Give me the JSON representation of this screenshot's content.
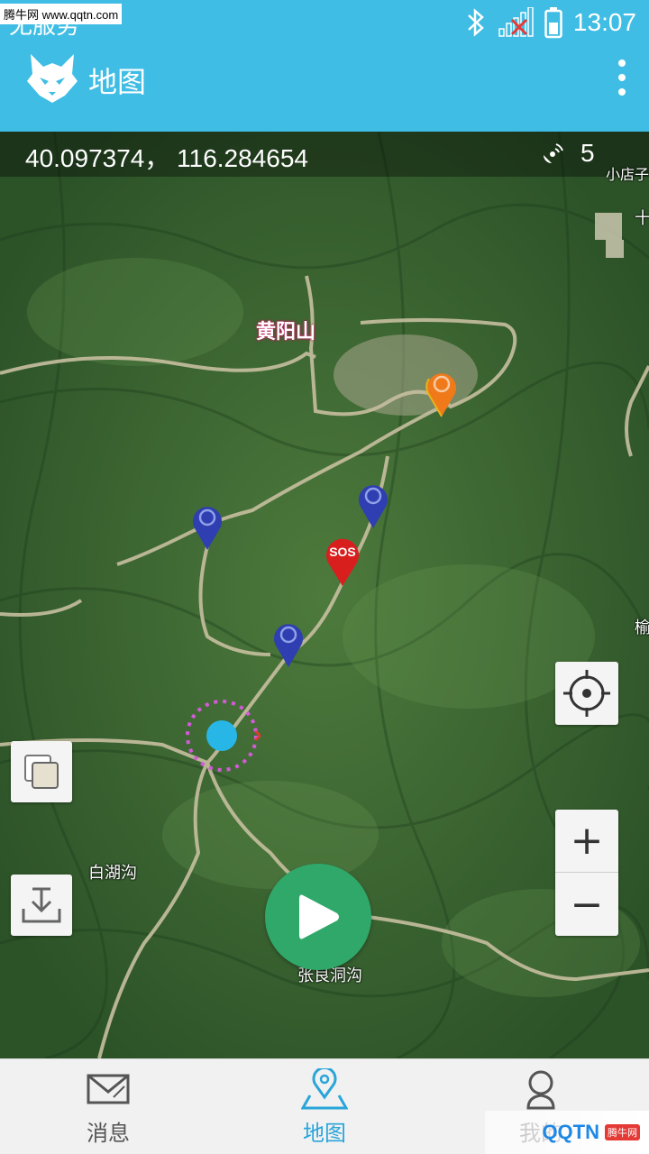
{
  "watermark": {
    "top": "腾牛网 www.qqtn.com",
    "brand": "QQTN",
    "sub": "腾牛网"
  },
  "status_bar": {
    "carrier": "无服务",
    "time": "13:07"
  },
  "app_bar": {
    "title": "地图"
  },
  "map": {
    "coordinates": "40.097374， 116.284654",
    "satellite_count": "5",
    "labels": {
      "mountain": "黄阳山",
      "village1": "白湖沟",
      "village2": "张良洞沟",
      "edge1": "小店子",
      "edge2": "十",
      "edge3": "榆"
    },
    "sos_label": "SOS"
  },
  "controls": {
    "zoom_in": "+",
    "zoom_out": "−"
  },
  "nav": {
    "items": [
      {
        "label": "消息",
        "icon": "mail-icon"
      },
      {
        "label": "地图",
        "icon": "map-pin-icon"
      },
      {
        "label": "我的",
        "icon": "user-icon"
      }
    ],
    "active": 1
  },
  "colors": {
    "accent": "#3fbde4",
    "play": "#2fa86a",
    "pin_blue": "#2f3eb0",
    "pin_orange": "#f07a1a",
    "pin_red": "#d91e1e"
  }
}
